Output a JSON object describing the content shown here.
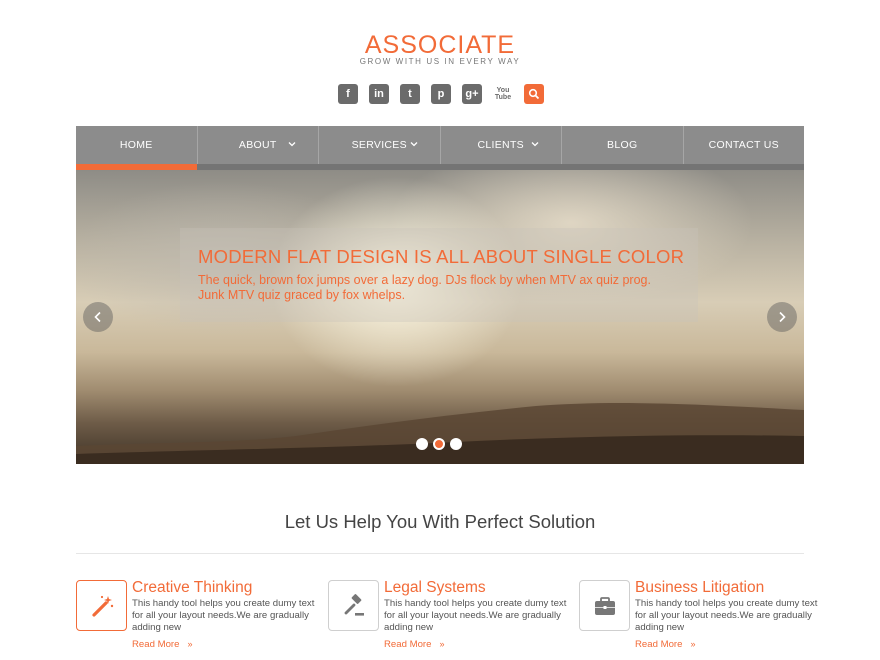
{
  "brand": {
    "title": "ASSOCIATE",
    "tagline": "GROW WITH US IN EVERY WAY",
    "accent_color": "#f26b38"
  },
  "social": [
    {
      "name": "facebook-icon",
      "glyph": "f"
    },
    {
      "name": "linkedin-icon",
      "glyph": "in"
    },
    {
      "name": "twitter-icon",
      "glyph": "t"
    },
    {
      "name": "pinterest-icon",
      "glyph": "p"
    },
    {
      "name": "google-plus-icon",
      "glyph": "g+"
    },
    {
      "name": "youtube-icon",
      "glyph": "You Tube"
    },
    {
      "name": "search-icon",
      "glyph": ""
    }
  ],
  "nav": {
    "items": [
      {
        "label": "HOME",
        "active": true,
        "dropdown": false
      },
      {
        "label": "ABOUT",
        "active": false,
        "dropdown": true
      },
      {
        "label": "SERVICES",
        "active": false,
        "dropdown": true
      },
      {
        "label": "CLIENTS",
        "active": false,
        "dropdown": true
      },
      {
        "label": "BLOG",
        "active": false,
        "dropdown": false
      },
      {
        "label": "CONTACT US",
        "active": false,
        "dropdown": false
      }
    ]
  },
  "slider": {
    "title": "MODERN FLAT DESIGN IS ALL ABOUT SINGLE COLOR",
    "text": "The quick, brown fox jumps over a lazy dog. DJs flock by when MTV ax quiz prog. Junk MTV quiz graced by fox whelps.",
    "slide_count": 3,
    "active_slide": 2
  },
  "section": {
    "title": "Let Us Help You With Perfect Solution"
  },
  "features": [
    {
      "title": "Creative Thinking",
      "text": "This handy tool helps you create dumy text for all your layout needs.We are gradually adding new",
      "more": "Read More",
      "icon": "magic-wand-icon"
    },
    {
      "title": "Legal Systems",
      "text": "This handy tool helps you create dumy text for all your layout needs.We are gradually adding new",
      "more": "Read More",
      "icon": "gavel-icon"
    },
    {
      "title": "Business Litigation",
      "text": "This handy tool helps you create dumy text for all your layout needs.We are gradually adding new",
      "more": "Read More",
      "icon": "briefcase-icon"
    }
  ]
}
